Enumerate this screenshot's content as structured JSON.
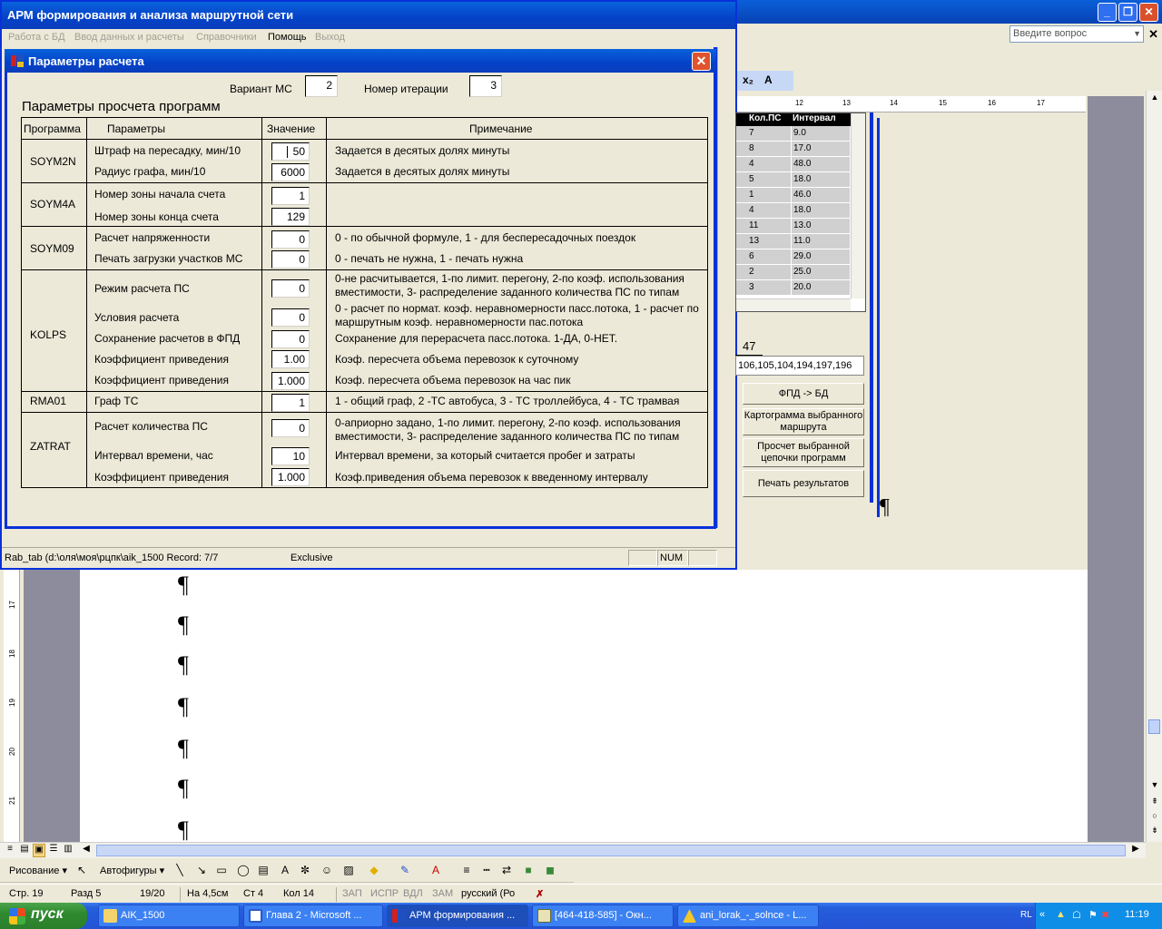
{
  "word": {
    "help_placeholder": "Введите вопрос",
    "toolbar_fmt": [
      "x₂",
      "A"
    ],
    "ruler_ticks": [
      "12",
      "13",
      "14",
      "15",
      "16",
      "17"
    ],
    "vruler_ticks": [
      "17",
      "18",
      "19",
      "20",
      "21"
    ],
    "drawing_menu": "Рисование ▾",
    "autoshapes_menu": "Автофигуры ▾",
    "status": {
      "page": "Стр. 19",
      "section": "Разд 5",
      "pages": "19/20",
      "position": "На 4,5см",
      "line": "Ст 4",
      "column": "Кол 14",
      "rec": "ЗАП",
      "trk": "ИСПР",
      "ext": "ВДЛ",
      "ovr": "ЗАМ",
      "language": "русский (Ро"
    }
  },
  "access": {
    "title": "АРМ формирования и анализа маршрутной сети",
    "menu": [
      "Работа с БД",
      "Ввод данных и расчеты",
      "Справочники",
      "Помощь",
      "Выход"
    ],
    "status_left": "Rab_tab (d:\\оля\\моя\\рцпк\\aik_1500 Record: 7/7",
    "status_mode": "Exclusive",
    "status_num": "NUM"
  },
  "background_form": {
    "grid_headers": [
      "Кол.ПС",
      "Интервал"
    ],
    "grid_rows": [
      [
        "7",
        "9.0"
      ],
      [
        "8",
        "17.0"
      ],
      [
        "4",
        "48.0"
      ],
      [
        "5",
        "18.0"
      ],
      [
        "1",
        "46.0"
      ],
      [
        "4",
        "18.0"
      ],
      [
        "11",
        "13.0"
      ],
      [
        "13",
        "11.0"
      ],
      [
        "6",
        "29.0"
      ],
      [
        "2",
        "25.0"
      ],
      [
        "3",
        "20.0"
      ]
    ],
    "field_value": "47",
    "route_text": "106,105,104,194,197,196",
    "buttons": [
      "ФПД -> БД",
      "Картограмма выбранного маршрута",
      "Просчет выбранной цепочки программ",
      "Печать результатов"
    ]
  },
  "dialog": {
    "title": "Параметры расчета",
    "variant_label": "Вариант МС",
    "variant_value": "2",
    "iteration_label": "Номер итерации",
    "iteration_value": "3",
    "section_title": "Параметры просчета программ",
    "columns": [
      "Программа",
      "Параметры",
      "Значение",
      "Примечание"
    ],
    "programs": [
      "SOYM2N",
      "SOYM4A",
      "SOYM09",
      "KOLPS",
      "RMA01",
      "ZATRAT"
    ],
    "rows": [
      {
        "param": "Штраф на пересадку, мин/10",
        "value": "50",
        "note": "Задается в десятых долях минуты"
      },
      {
        "param": "Радиус графа, мин/10",
        "value": "6000",
        "note": "Задается в десятых долях минуты"
      },
      {
        "param": "Номер зоны начала счета",
        "value": "1",
        "note": ""
      },
      {
        "param": "Номер зоны конца счета",
        "value": "129",
        "note": ""
      },
      {
        "param": "Расчет напряженности",
        "value": "0",
        "note": "0 - по обычной формуле, 1 - для беспересадочных поездок"
      },
      {
        "param": "Печать загрузки участков МС",
        "value": "0",
        "note": "0 - печать не нужна, 1 - печать нужна"
      },
      {
        "param": "Режим расчета ПС",
        "value": "0",
        "note": "0-не расчитывается, 1-по лимит. перегону, 2-по коэф. использования вместимости, 3- распределение заданного количества ПС по типам"
      },
      {
        "param": "Условия расчета",
        "value": "0",
        "note": "0 - расчет по нормат. коэф. неравномерности пасс.потока, 1 - расчет по маршрутным коэф. неравномерности пас.потока"
      },
      {
        "param": "Сохранение расчетов в ФПД",
        "value": "0",
        "note": "Сохранение для перерасчета пасс.потока. 1-ДА, 0-НЕТ."
      },
      {
        "param": "Коэффициент приведения",
        "value": "1.00",
        "note": "Коэф. пересчета объема перевозок к суточному"
      },
      {
        "param": "Коэффициент приведения",
        "value": "1.000",
        "note": "Коэф. пересчета объема перевозок на час пик"
      },
      {
        "param": "Граф ТС",
        "value": "1",
        "note": "1 - общий граф, 2 -ТС автобуса, 3 - ТС троллейбуса, 4 - ТС трамвая"
      },
      {
        "param": "Расчет количества ПС",
        "value": "0",
        "note": "0-априорно задано, 1-по лимит. перегону, 2-по коэф. использования вместимости, 3-  распределение заданного количества ПС по типам"
      },
      {
        "param": "Интервал времени, час",
        "value": "10",
        "note": "Интервал времени, за который считается пробег и затраты"
      },
      {
        "param": "Коэффициент приведения",
        "value": "1.000",
        "note": "Коэф.приведения объема перевозок к введенному интервалу"
      }
    ]
  },
  "taskbar": {
    "start_label": "пуск",
    "tasks": [
      "AIK_1500",
      "Глава 2 - Microsoft ...",
      "АРМ формирования ...",
      "[464-418-585] - Окн...",
      "ani_lorak_-_solnce - L..."
    ],
    "language": "RL",
    "clock": "11:19"
  },
  "colors": {
    "xp_blue": "#0831d9",
    "title_gradient": "#0a62dc",
    "dialog_bg": "#ece9d8",
    "close_red": "#e0532e",
    "grid_header": "#000000",
    "grid_cell": "#d0d0d0"
  }
}
